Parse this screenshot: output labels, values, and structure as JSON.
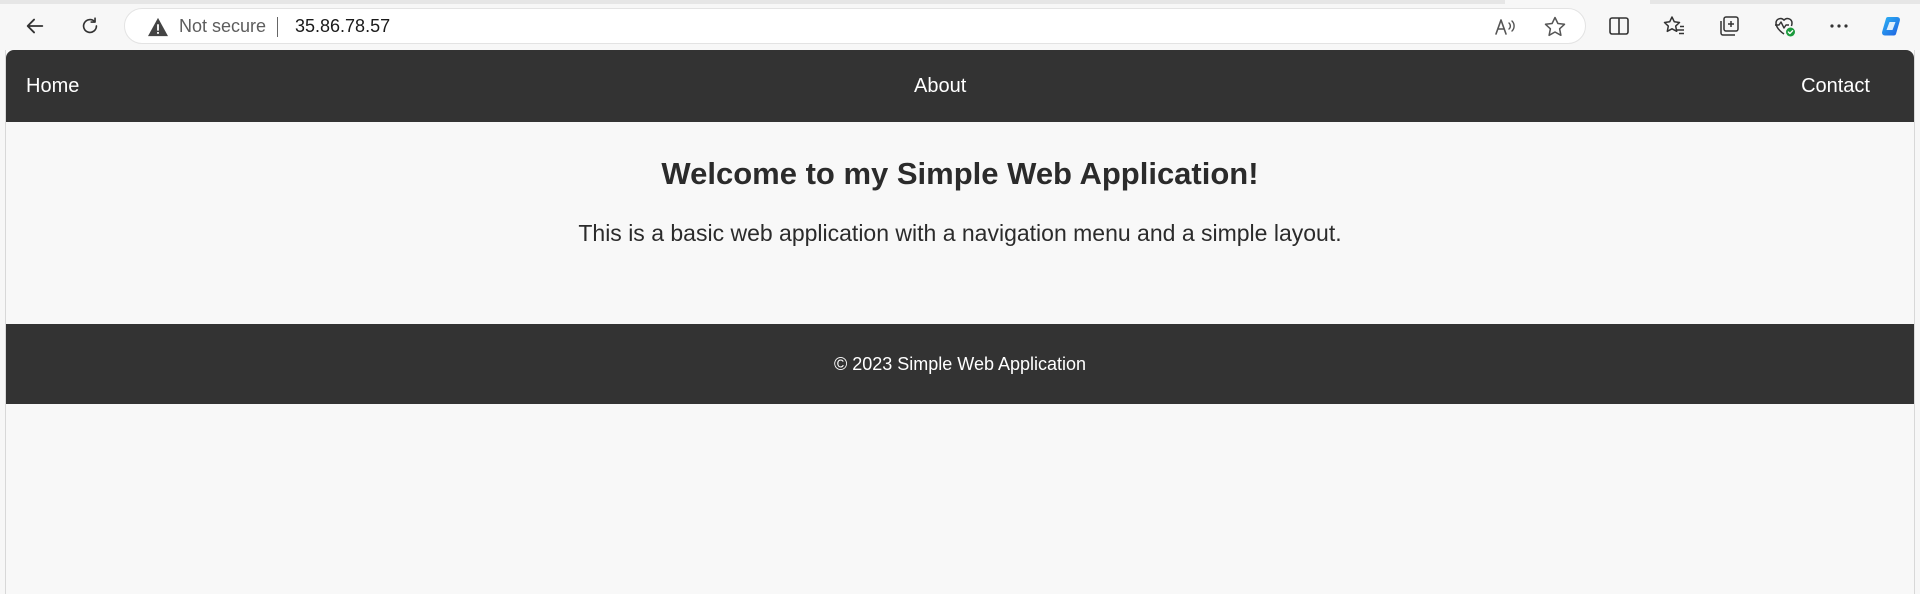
{
  "browser": {
    "security_label": "Not secure",
    "url": "35.86.78.57",
    "icons": {
      "back": "back-arrow-icon",
      "refresh": "refresh-icon",
      "warning": "warning-triangle-icon",
      "read_aloud": "read-aloud-icon",
      "favorite": "star-icon",
      "split_screen": "split-screen-icon",
      "favorites": "favorites-icon",
      "collections": "collections-icon",
      "browser_essentials": "heart-pulse-icon",
      "more": "more-icon",
      "copilot": "copilot-icon"
    }
  },
  "nav": {
    "home": "Home",
    "about": "About",
    "contact": "Contact"
  },
  "main": {
    "title": "Welcome to my Simple Web Application!",
    "description": "This is a basic web application with a navigation menu and a simple layout."
  },
  "footer": {
    "text": "© 2023 Simple Web Application"
  },
  "colors": {
    "nav_bg": "#333333",
    "footer_bg": "#333333",
    "page_bg": "#f8f8f8",
    "text": "#2b2b2b",
    "health_badge": "#1b9a3c"
  }
}
